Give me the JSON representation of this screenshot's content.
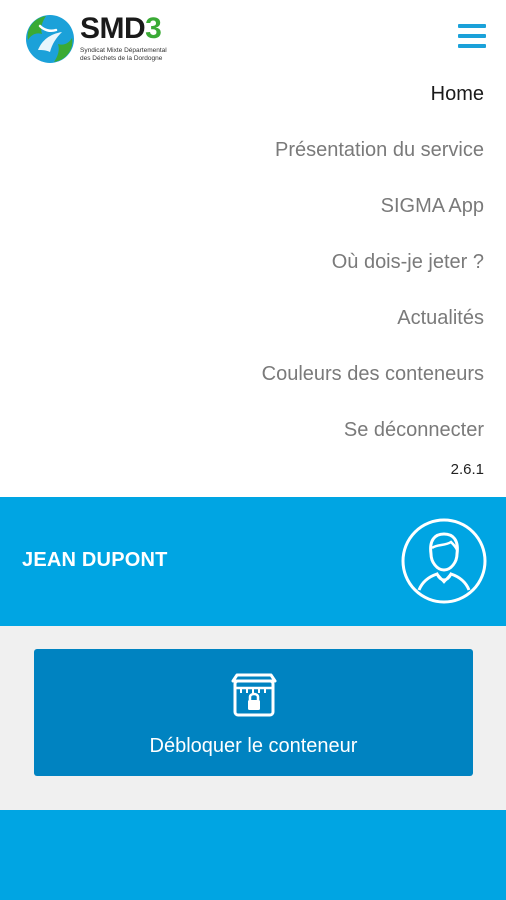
{
  "header": {
    "logo": {
      "title_main": "SMD",
      "title_digit": "3",
      "subtitle": "Syndicat Mixte Départemental des Déchets de la Dordogne",
      "colors": {
        "blue": "#1ba1d9",
        "green": "#3aaa35"
      }
    },
    "menu_icon": "hamburger-icon"
  },
  "menu": {
    "items": [
      {
        "label": "Home",
        "active": true
      },
      {
        "label": "Présentation du service",
        "active": false
      },
      {
        "label": "SIGMA App",
        "active": false
      },
      {
        "label": "Où dois-je jeter ?",
        "active": false
      },
      {
        "label": "Actualités",
        "active": false
      },
      {
        "label": "Couleurs des conteneurs",
        "active": false
      },
      {
        "label": "Se déconnecter",
        "active": false
      }
    ],
    "version": "2.6.1"
  },
  "user": {
    "name": "JEAN DUPONT",
    "avatar_icon": "user-avatar-icon"
  },
  "actions": {
    "unlock_label": "Débloquer le conteneur",
    "unlock_icon": "container-lock-icon"
  },
  "colors": {
    "primary": "#00a5e3",
    "button": "#0083c1",
    "active_text": "#1a1a1a",
    "menu_text": "#7a7a7a",
    "content_bg": "#f0f0f0"
  }
}
